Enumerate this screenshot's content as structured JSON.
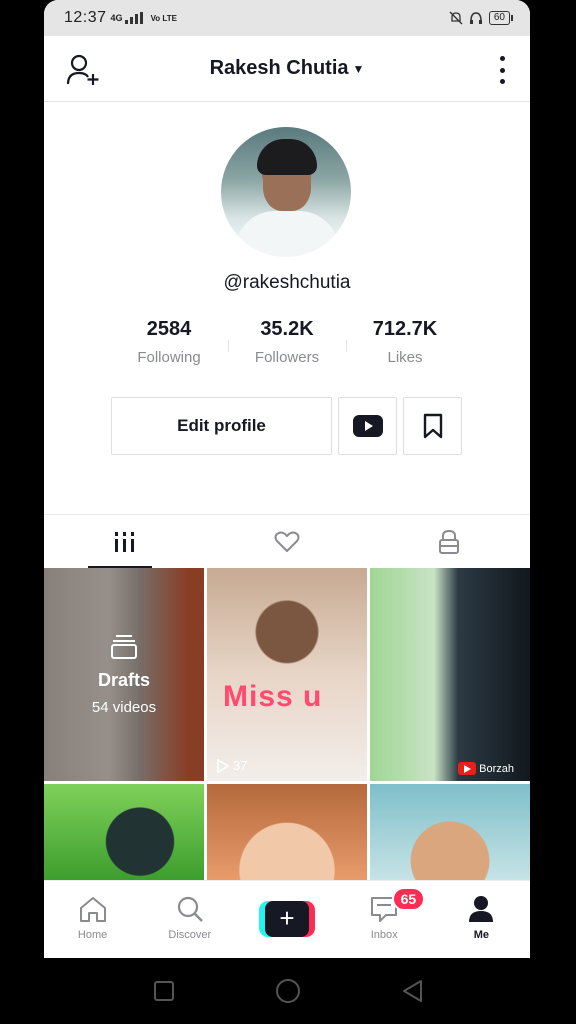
{
  "status_bar": {
    "time": "12:37",
    "network": "4G",
    "volte": "Vo LTE",
    "battery": "60"
  },
  "header": {
    "title": "Rakesh Chutia"
  },
  "profile": {
    "handle": "@rakeshchutia",
    "stats": [
      {
        "value": "2584",
        "label": "Following"
      },
      {
        "value": "35.2K",
        "label": "Followers"
      },
      {
        "value": "712.7K",
        "label": "Likes"
      }
    ],
    "edit_label": "Edit profile"
  },
  "tabs": [
    "videos-grid-icon",
    "heart-icon",
    "lock-icon"
  ],
  "grid": {
    "drafts": {
      "name": "Drafts",
      "count": "54 videos"
    },
    "video2": {
      "caption": "Miss u",
      "plays": "37"
    },
    "video3": {
      "source": "Borzah"
    }
  },
  "nav": {
    "home": "Home",
    "discover": "Discover",
    "inbox": "Inbox",
    "inbox_badge": "65",
    "me": "Me"
  },
  "colors": {
    "primary": "#fe2c55",
    "accent": "#25f4ee",
    "text": "#161823",
    "muted": "#8a8b91"
  }
}
